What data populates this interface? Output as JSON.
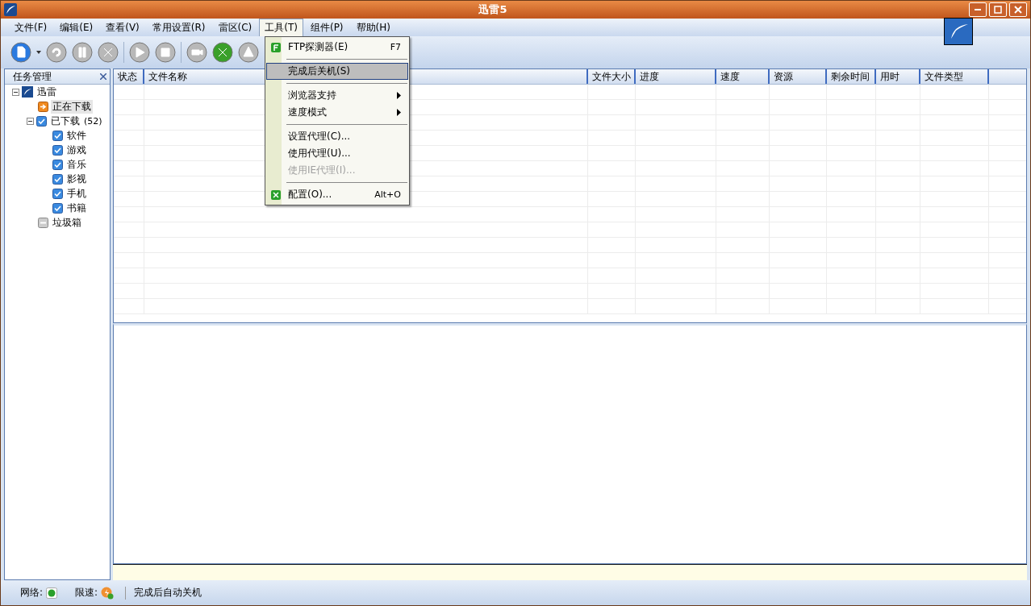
{
  "window": {
    "title": "迅雷5"
  },
  "menu_bar": [
    {
      "label": "文件(F)",
      "selected": false
    },
    {
      "label": "编辑(E)",
      "selected": false
    },
    {
      "label": "查看(V)",
      "selected": false
    },
    {
      "label": "常用设置(R)",
      "selected": false
    },
    {
      "label": "雷区(C)",
      "selected": false
    },
    {
      "label": "工具(T)",
      "selected": true
    },
    {
      "label": "组件(P)",
      "selected": false
    },
    {
      "label": "帮助(H)",
      "selected": false
    }
  ],
  "dropdown": [
    {
      "kind": "ftp_item",
      "label": "FTP探测器(E)",
      "shortcut": "F7",
      "selected": false,
      "disabled": false
    },
    {
      "kind": "separator"
    },
    {
      "kind": "item",
      "label": "完成后关机(S)",
      "selected": true,
      "disabled": false
    },
    {
      "kind": "separator"
    },
    {
      "kind": "submenu",
      "label": "浏览器支持",
      "selected": false,
      "disabled": false
    },
    {
      "kind": "submenu",
      "label": "速度模式",
      "selected": false,
      "disabled": false
    },
    {
      "kind": "separator"
    },
    {
      "kind": "item",
      "label": "设置代理(C)...",
      "selected": false,
      "disabled": false
    },
    {
      "kind": "item",
      "label": "使用代理(U)...",
      "selected": false,
      "disabled": false
    },
    {
      "kind": "item",
      "label": "使用IE代理(I)...",
      "selected": false,
      "disabled": true
    },
    {
      "kind": "separator"
    },
    {
      "kind": "config_item",
      "label": "配置(O)...",
      "shortcut": "Alt+O",
      "selected": false,
      "disabled": false
    }
  ],
  "sidebar": {
    "title": "任务管理",
    "items": [
      {
        "label": "迅雷",
        "kind": "root",
        "selected": false,
        "expanded": true,
        "children": [
          {
            "label": "正在下载",
            "kind": "downloading",
            "selected": true
          },
          {
            "label": "已下载",
            "count": "(52)",
            "kind": "folder",
            "selected": false,
            "expanded": true,
            "children": [
              {
                "label": "软件",
                "kind": "folder",
                "selected": false
              },
              {
                "label": "游戏",
                "kind": "folder",
                "selected": false
              },
              {
                "label": "音乐",
                "kind": "folder",
                "selected": false
              },
              {
                "label": "影视",
                "kind": "folder",
                "selected": false
              },
              {
                "label": "手机",
                "kind": "folder",
                "selected": false
              },
              {
                "label": "书籍",
                "kind": "folder",
                "selected": false
              }
            ]
          },
          {
            "label": "垃圾箱",
            "kind": "trash",
            "selected": false
          }
        ]
      }
    ]
  },
  "table": {
    "columns": [
      "状态",
      "文件名称",
      "文件大小",
      "进度",
      "速度",
      "资源",
      "剩余时间",
      "用时",
      "文件类型"
    ]
  },
  "status_bar": {
    "network_label": "网络:",
    "speed_label": "限速:",
    "message": "完成后自动关机"
  }
}
